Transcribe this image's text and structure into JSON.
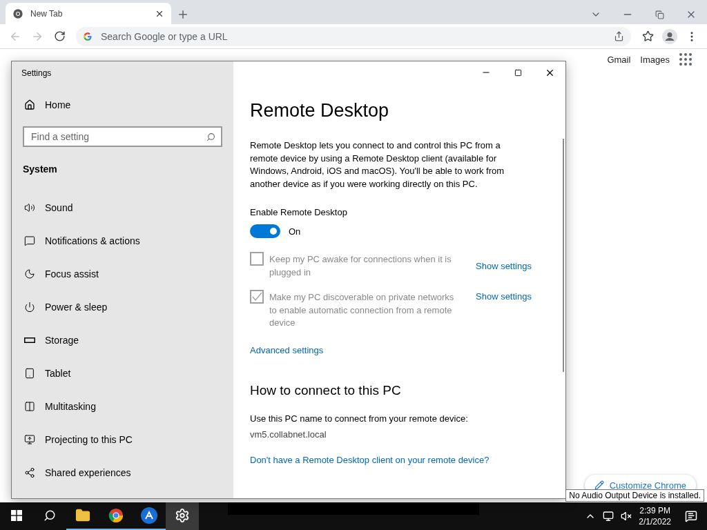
{
  "browser": {
    "tab": {
      "title": "New Tab",
      "selected": true
    },
    "address_bar": {
      "placeholder": "Search Google or type a URL"
    },
    "links": [
      "Gmail",
      "Images"
    ],
    "customize_button": "Customize Chrome"
  },
  "settings_window": {
    "title": "Settings",
    "sidebar": {
      "home": "Home",
      "search": {
        "placeholder": "Find a setting"
      },
      "section": "System",
      "items": [
        {
          "label": "Sound",
          "selected": false
        },
        {
          "label": "Notifications & actions",
          "selected": false
        },
        {
          "label": "Focus assist",
          "selected": false
        },
        {
          "label": "Power & sleep",
          "selected": false
        },
        {
          "label": "Storage",
          "selected": false
        },
        {
          "label": "Tablet",
          "selected": false
        },
        {
          "label": "Multitasking",
          "selected": false
        },
        {
          "label": "Projecting to this PC",
          "selected": false
        },
        {
          "label": "Shared experiences",
          "selected": false
        }
      ]
    },
    "page": {
      "title": "Remote Desktop",
      "description": "Remote Desktop lets you connect to and control this PC from a remote device by using a Remote Desktop client (available for Windows, Android, iOS and macOS). You'll be able to work from another device as if you were working directly on this PC.",
      "enable": {
        "label": "Enable Remote Desktop",
        "on": true,
        "state_text": "On"
      },
      "options": [
        {
          "label": "Keep my PC awake for connections when it is plugged in",
          "checked": false,
          "disabled": true,
          "link": "Show settings"
        },
        {
          "label": "Make my PC discoverable on private networks to enable automatic connection from a remote device",
          "checked": true,
          "disabled": true,
          "link": "Show settings"
        }
      ],
      "advanced_link": "Advanced settings",
      "connect_heading": "How to connect to this PC",
      "connect_text": "Use this PC name to connect from your remote device:",
      "pc_name": "vm5.collabnet.local",
      "client_link": "Don't have a Remote Desktop client on your remote device?"
    }
  },
  "taskbar": {
    "apps": [
      {
        "running": true,
        "selected": false
      },
      {
        "running": true,
        "selected": false
      },
      {
        "running": true,
        "selected": false
      },
      {
        "running": false,
        "selected": true
      }
    ],
    "time": "2:39 PM",
    "date": "2/1/2022",
    "tooltip": "No Audio Output Device is installed."
  }
}
